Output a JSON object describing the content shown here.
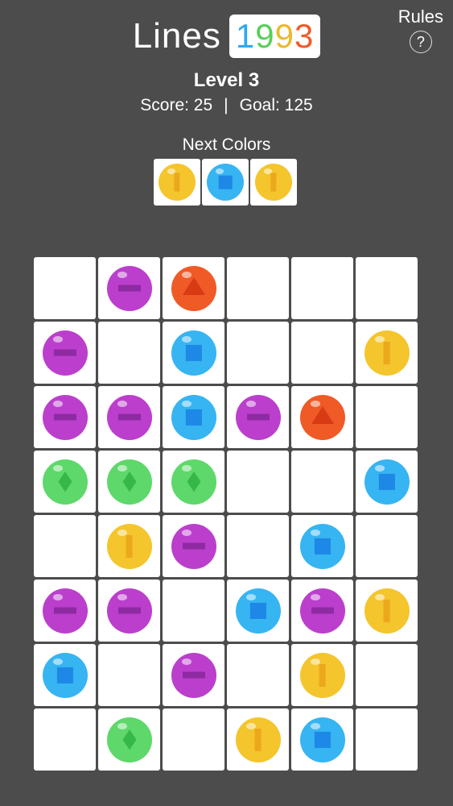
{
  "header": {
    "title": "Lines",
    "year_digits": [
      {
        "char": "1",
        "color": "#2eaaf0"
      },
      {
        "char": "9",
        "color": "#58cf58"
      },
      {
        "char": "9",
        "color": "#ebb92e"
      },
      {
        "char": "3",
        "color": "#ee5c2a"
      }
    ],
    "rules_label": "Rules",
    "rules_icon": "?"
  },
  "status": {
    "level_text": "Level 3",
    "score_label": "Score: 25",
    "separator": "|",
    "goal_label": "Goal: 125"
  },
  "next": {
    "label": "Next Colors",
    "balls": [
      "yellow",
      "blue",
      "yellow"
    ]
  },
  "ball_types": {
    "purple": {
      "color": "#bb3fcc",
      "symbol": "bar-icon",
      "symbol_color": "#8e2aa2"
    },
    "orange": {
      "color": "#ef5a26",
      "symbol": "triangle-icon",
      "symbol_color": "#d83a14"
    },
    "blue": {
      "color": "#37b4f2",
      "symbol": "square-icon",
      "symbol_color": "#1d88e6"
    },
    "yellow": {
      "color": "#f4c52c",
      "symbol": "vertical-bar-icon",
      "symbol_color": "#eba81d"
    },
    "green": {
      "color": "#5ed86a",
      "symbol": "diamond-icon",
      "symbol_color": "#36b847"
    }
  },
  "board": {
    "rows": 8,
    "cols": 6,
    "cells": [
      [
        "",
        "purple",
        "orange",
        "",
        "",
        ""
      ],
      [
        "purple",
        "",
        "blue",
        "",
        "",
        "yellow"
      ],
      [
        "purple",
        "purple",
        "blue",
        "purple",
        "orange",
        ""
      ],
      [
        "green",
        "green",
        "green",
        "",
        "",
        "blue"
      ],
      [
        "",
        "yellow",
        "purple",
        "",
        "blue",
        ""
      ],
      [
        "purple",
        "purple",
        "",
        "blue",
        "purple",
        "yellow"
      ],
      [
        "blue",
        "",
        "purple",
        "",
        "yellow",
        ""
      ],
      [
        "",
        "green",
        "",
        "yellow",
        "blue",
        ""
      ]
    ]
  }
}
